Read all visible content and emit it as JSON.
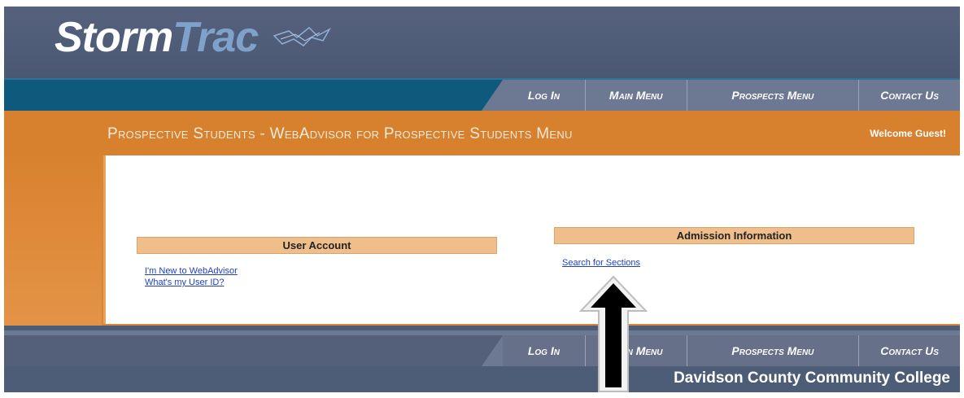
{
  "logo": {
    "part1": "Storm",
    "part2": "Trac"
  },
  "nav": {
    "items": [
      "Log In",
      "Main Menu",
      "Prospects Menu",
      "Contact Us"
    ],
    "bottom_items": [
      "Log In",
      "Main Menu",
      "Prospects Menu",
      "Contact Us"
    ]
  },
  "page": {
    "title": "Prospective Students - WebAdvisor for Prospective Students Menu",
    "welcome": "Welcome Guest!"
  },
  "user_account": {
    "header": "User Account",
    "links": [
      "I'm New to WebAdvisor",
      "What's my User ID?"
    ]
  },
  "admission": {
    "header": "Admission Information",
    "links": [
      "Search for Sections"
    ]
  },
  "footer": {
    "college": "Davidson County Community College"
  },
  "colors": {
    "header_bg": "#4e5d77",
    "navbar": "#0e5a7c",
    "orange": "#d7802e",
    "panel": "#efbe8a"
  }
}
